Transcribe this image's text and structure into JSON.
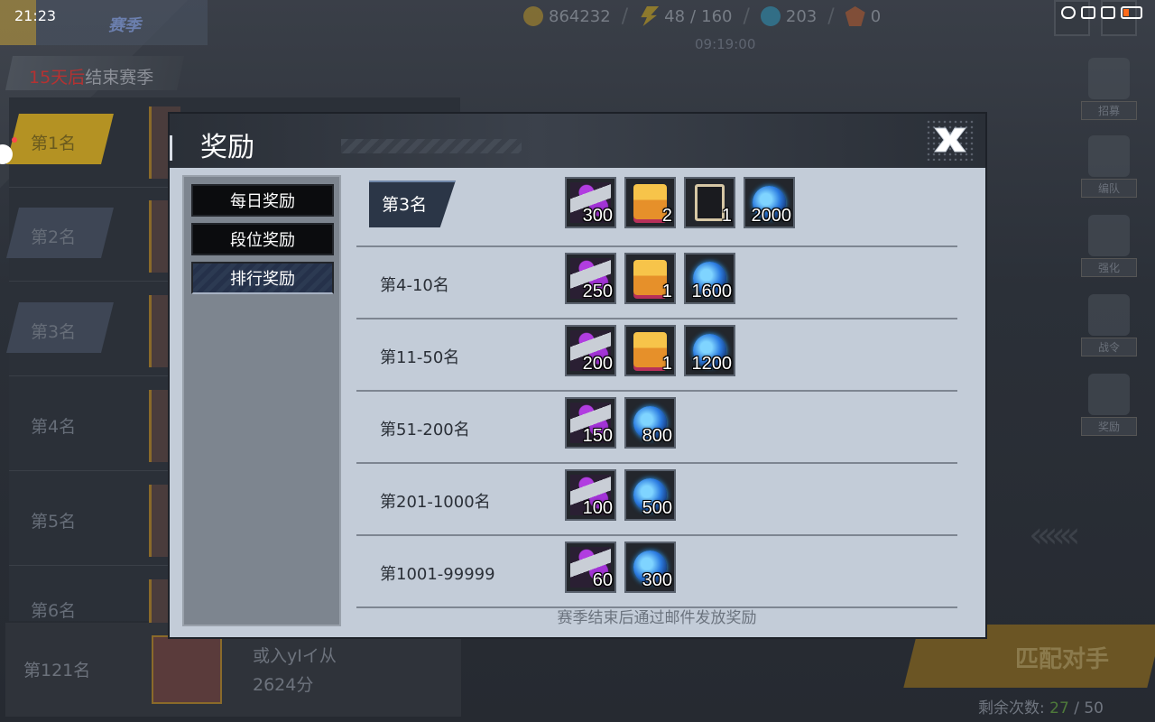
{
  "status_bar": {
    "time": "21:23"
  },
  "header": {
    "season_tab": "赛季",
    "resources": {
      "coins": "864232",
      "energy": "48",
      "energy_max": "160",
      "gems": "203",
      "crystals": "0"
    },
    "timer": "09:19:00"
  },
  "season": {
    "days_left": "15天后",
    "end_text": "结束赛季"
  },
  "rank_list": [
    "第1名",
    "第2名",
    "第3名",
    "第4名",
    "第5名",
    "第6名"
  ],
  "my_rank": {
    "rank": "第121名",
    "name": "或入yIイ从",
    "score": "2624分"
  },
  "side_menu": [
    "招募",
    "编队",
    "强化",
    "战令",
    "奖励"
  ],
  "match": {
    "button": "匹配对手",
    "remaining_label": "剩余次数:",
    "remaining": "27",
    "remaining_sep": "/",
    "remaining_max": "50"
  },
  "modal": {
    "title": "奖励",
    "tabs": [
      "每日奖励",
      "段位奖励",
      "排行奖励"
    ],
    "active_tab": "排行奖励",
    "rows": [
      {
        "rank": "第3名",
        "items": [
          {
            "icon": "shard",
            "count": "300"
          },
          {
            "icon": "chest",
            "count": "2"
          },
          {
            "icon": "frame",
            "count": "1"
          },
          {
            "icon": "orb",
            "count": "2000"
          }
        ]
      },
      {
        "rank": "第4-10名",
        "items": [
          {
            "icon": "shard",
            "count": "250"
          },
          {
            "icon": "chest",
            "count": "1"
          },
          {
            "icon": "orb",
            "count": "1600"
          }
        ]
      },
      {
        "rank": "第11-50名",
        "items": [
          {
            "icon": "shard",
            "count": "200"
          },
          {
            "icon": "chest",
            "count": "1"
          },
          {
            "icon": "orb",
            "count": "1200"
          }
        ]
      },
      {
        "rank": "第51-200名",
        "items": [
          {
            "icon": "shard",
            "count": "150"
          },
          {
            "icon": "orb",
            "count": "800"
          }
        ]
      },
      {
        "rank": "第201-1000名",
        "items": [
          {
            "icon": "shard",
            "count": "100"
          },
          {
            "icon": "orb",
            "count": "500"
          }
        ]
      },
      {
        "rank": "第1001-99999",
        "items": [
          {
            "icon": "shard",
            "count": "60"
          },
          {
            "icon": "orb",
            "count": "300"
          }
        ]
      }
    ],
    "footer": "赛季结束后通过邮件发放奖励"
  },
  "colors": {
    "accent_gold": "#b49223",
    "modal_bg": "#c3ccd8",
    "tab_active": "#2c3a52",
    "remaining_green": "#4e7a3a"
  }
}
